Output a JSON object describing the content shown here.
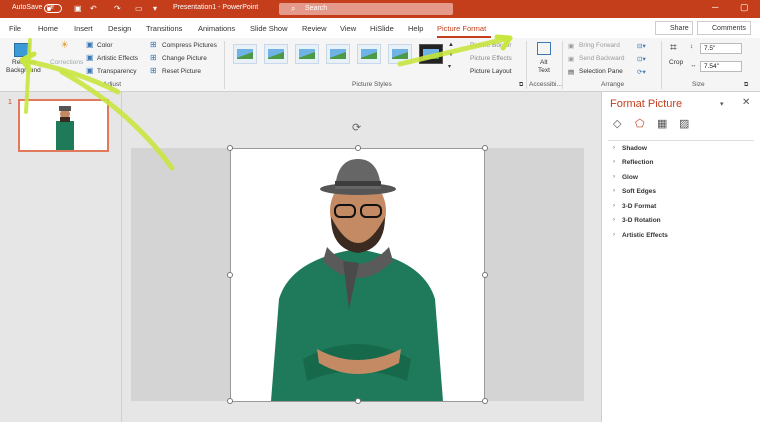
{
  "titlebar": {
    "autosave": "AutoSave",
    "toggle_state": "Off",
    "doc_title": "Presentation1 - PowerPoint",
    "search_placeholder": "Search"
  },
  "tabs": [
    "File",
    "Home",
    "Insert",
    "Design",
    "Transitions",
    "Animations",
    "Slide Show",
    "Review",
    "View",
    "HiSlide",
    "Help",
    "Picture Format"
  ],
  "active_tab": "Picture Format",
  "share_label": "Share",
  "comments_label": "Comments",
  "ribbon": {
    "remove_bg": [
      "Remove",
      "Background"
    ],
    "corrections": "Corrections",
    "color": "Color",
    "artistic": "Artistic Effects",
    "transparency": "Transparency",
    "compress": "Compress Pictures",
    "change": "Change Picture",
    "reset": "Reset Picture",
    "group_adjust": "Adjust",
    "group_styles": "Picture Styles",
    "border": "Picture Border",
    "effects": "Picture Effects",
    "layout": "Picture Layout",
    "alt_text": [
      "Alt",
      "Text"
    ],
    "group_access": "Accessibi...",
    "bring_forward": "Bring Forward",
    "send_backward": "Send Backward",
    "selection_pane": "Selection Pane",
    "group_arrange": "Arrange",
    "crop": "Crop",
    "height": "7.5\"",
    "width": "7.54\"",
    "group_size": "Size"
  },
  "slide_number": "1",
  "format_pane": {
    "title": "Format Picture",
    "items": [
      "Shadow",
      "Reflection",
      "Glow",
      "Soft Edges",
      "3-D Format",
      "3-D Rotation",
      "Artistic Effects"
    ]
  },
  "colors": {
    "accent": "#c43e1c",
    "highlight": "#c8e640"
  }
}
